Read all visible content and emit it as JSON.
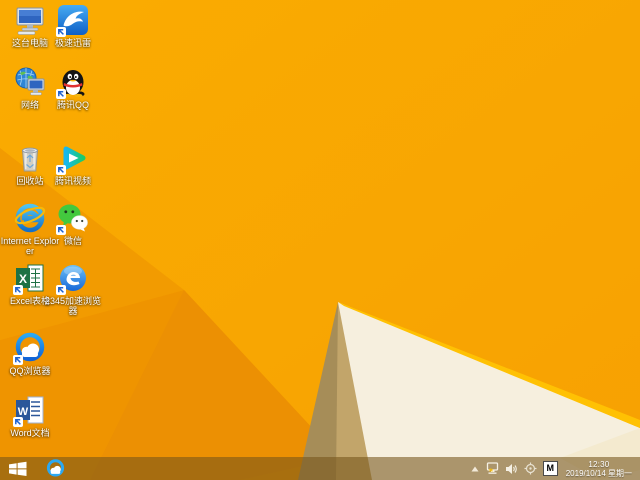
{
  "theme": {
    "wallpaper_orange": "#F9A602",
    "wallpaper_orange_shade1": "#F29B01",
    "wallpaper_orange_shade2": "#EF9400",
    "wallpaper_tan_dark": "#A68D58",
    "wallpaper_tan_light": "#C2A56A",
    "wallpaper_cream": "#F6EFDE",
    "ridge_yellow": "#FFC103",
    "taskbar_overlay": "rgba(118,84,26,0.58)",
    "label_text_color": "#FFFFFF"
  },
  "desktop": {
    "icons": [
      {
        "id": "this-pc",
        "label": "这台电脑"
      },
      {
        "id": "thunder",
        "label": "极速迅雷"
      },
      {
        "id": "network",
        "label": "网络"
      },
      {
        "id": "tencent-qq",
        "label": "腾讯QQ"
      },
      {
        "id": "recycle-bin",
        "label": "回收站"
      },
      {
        "id": "tencent-video",
        "label": "腾讯视频"
      },
      {
        "id": "internet-explorer",
        "label": "Internet Explorer"
      },
      {
        "id": "wechat",
        "label": "微信"
      },
      {
        "id": "excel",
        "label": "Excel表格"
      },
      {
        "id": "browser-2345",
        "label": "2345加速浏览器"
      },
      {
        "id": "qq-browser",
        "label": "QQ浏览器"
      },
      {
        "id": "word",
        "label": "Word文档"
      }
    ]
  },
  "taskbar": {
    "start_tooltip": "开始",
    "pinned": [
      {
        "id": "qq-browser-taskbar",
        "label": "QQ浏览器"
      }
    ],
    "tray": {
      "hidden_icons": "show-hidden-icons",
      "network_status": "network-warning",
      "volume": "speaker",
      "utility": "crosshair",
      "ime_indicator": "M",
      "time": "12:30",
      "date": "2019/10/14 星期一"
    }
  }
}
